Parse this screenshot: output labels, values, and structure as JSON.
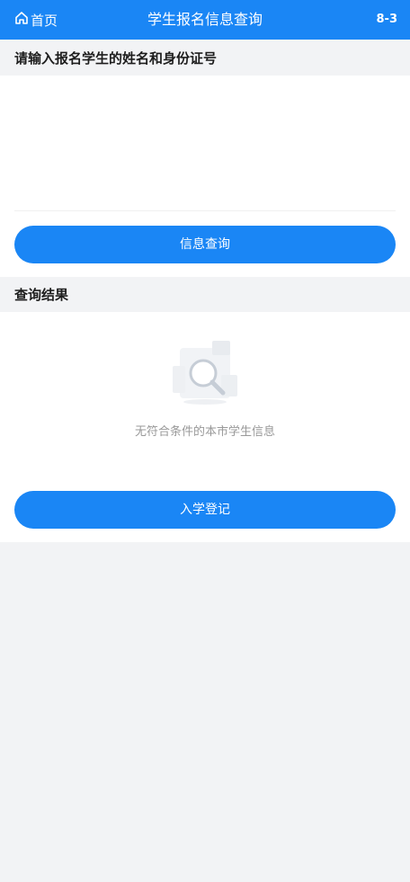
{
  "header": {
    "home_label": "首页",
    "title": "学生报名信息查询",
    "version": "8-3",
    "bg_color": "#1a86f5"
  },
  "query_section": {
    "title": "请输入报名学生的姓名和身份证号",
    "button_label": "信息查询"
  },
  "result_section": {
    "title": "查询结果",
    "empty_icon": "search-empty-icon",
    "empty_text": "无符合条件的本市学生信息",
    "button_label": "入学登记"
  }
}
